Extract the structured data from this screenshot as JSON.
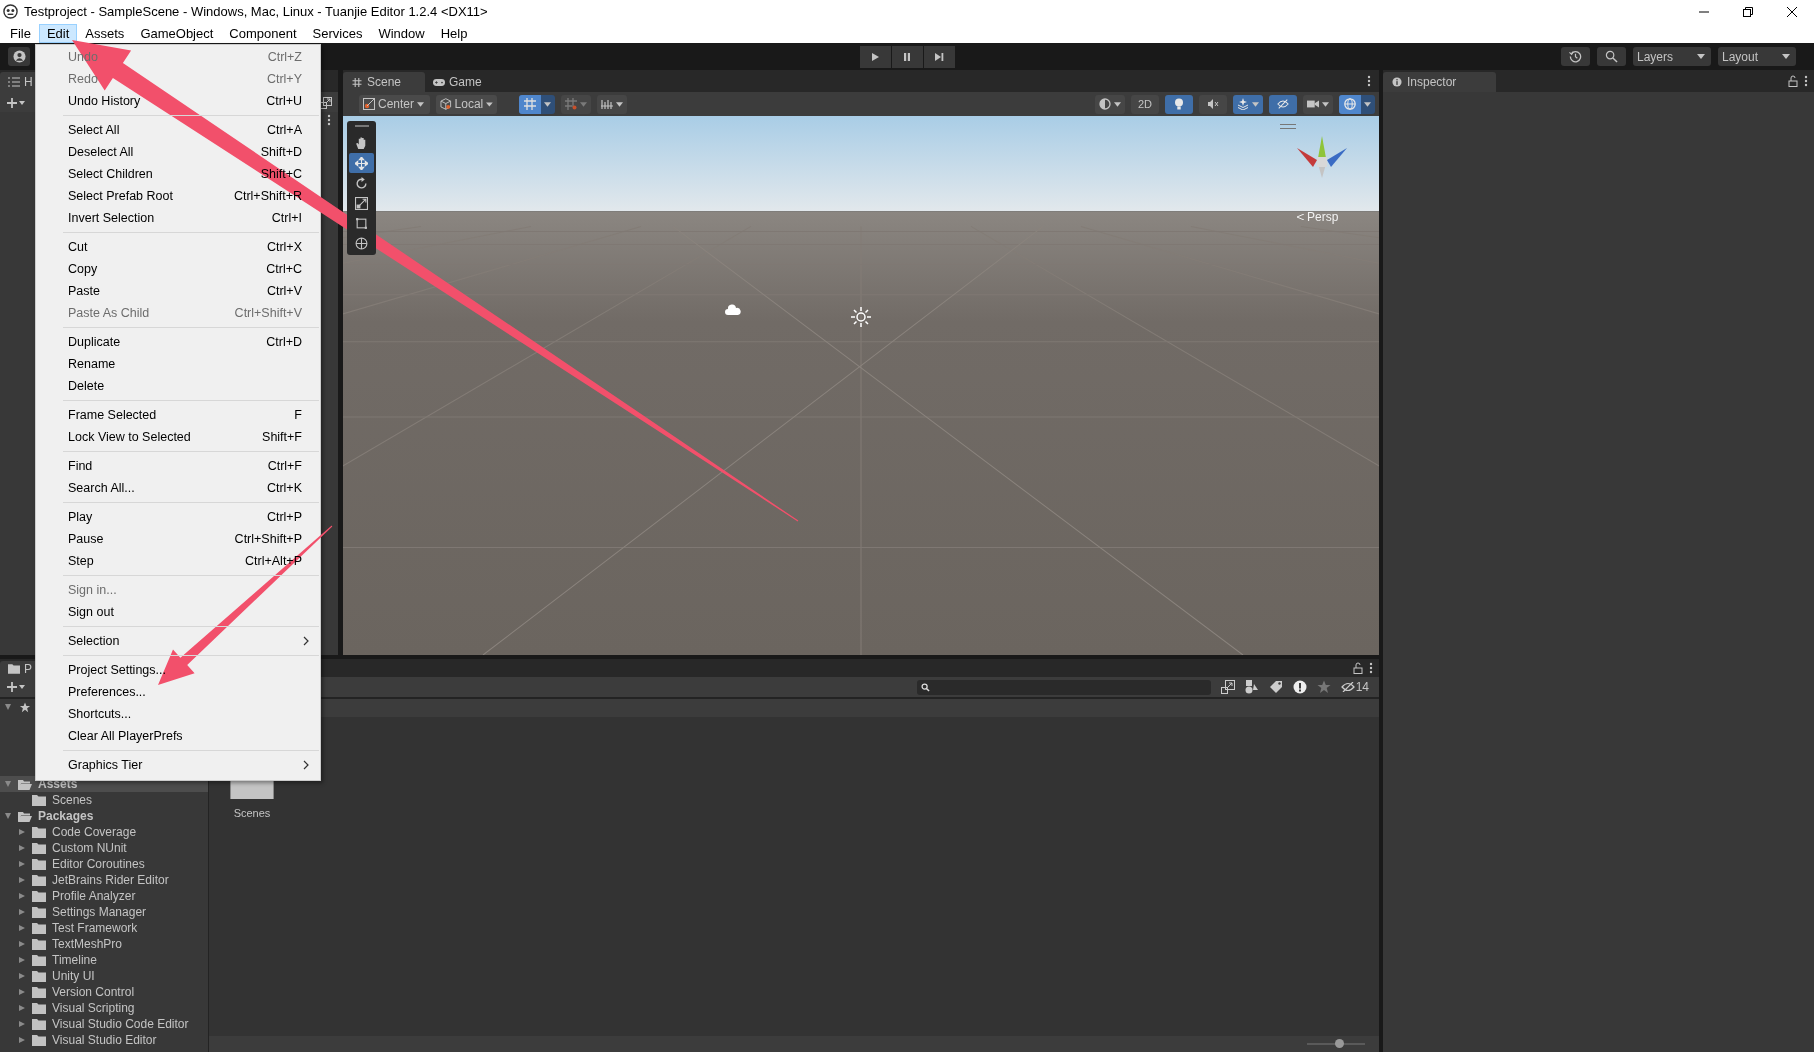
{
  "window": {
    "title": "Testproject - SampleScene - Windows, Mac, Linux - Tuanjie Editor 1.2.4 <DX11>"
  },
  "menu_bar": [
    {
      "label": "File",
      "selected": false
    },
    {
      "label": "Edit",
      "selected": true
    },
    {
      "label": "Assets",
      "selected": false
    },
    {
      "label": "GameObject",
      "selected": false
    },
    {
      "label": "Component",
      "selected": false
    },
    {
      "label": "Services",
      "selected": false
    },
    {
      "label": "Window",
      "selected": false
    },
    {
      "label": "Help",
      "selected": false
    }
  ],
  "toolbar": {
    "playing": false,
    "paused": false,
    "layers_label": "Layers",
    "layout_label": "Layout"
  },
  "hierarchy": {
    "tab_label": "H"
  },
  "scene_view": {
    "tabs": [
      {
        "label": "Scene",
        "selected": true
      },
      {
        "label": "Game",
        "selected": false
      }
    ],
    "pivot_label": "Center",
    "space_label": "Local",
    "grid_snap_on": true,
    "two_d_label": "2D",
    "two_d_on": false,
    "lighting_on": true,
    "audio_on": false,
    "effects_on": true,
    "hidden_objects_on": true,
    "gizmos_on": true,
    "tools": [
      {
        "selected": false
      },
      {
        "selected": true
      },
      {
        "selected": false
      },
      {
        "selected": false
      },
      {
        "selected": false
      },
      {
        "selected": false
      }
    ],
    "camera_label": "Persp"
  },
  "inspector": {
    "tab_label": "Inspector"
  },
  "project": {
    "tab_label": "P",
    "hidden_packages_count": "14",
    "favorites_expanded": true,
    "tree": [
      {
        "label": "Assets",
        "expanded": true,
        "selected": true,
        "children": [
          {
            "label": "Scenes",
            "selected": false
          }
        ]
      },
      {
        "label": "Packages",
        "expanded": true,
        "selected": false,
        "children": [
          {
            "label": "Code Coverage",
            "expanded": false,
            "selected": false
          },
          {
            "label": "Custom NUnit",
            "expanded": false,
            "selected": false
          },
          {
            "label": "Editor Coroutines",
            "expanded": false,
            "selected": false
          },
          {
            "label": "JetBrains Rider Editor",
            "expanded": false,
            "selected": false
          },
          {
            "label": "Profile Analyzer",
            "expanded": false,
            "selected": false
          },
          {
            "label": "Settings Manager",
            "expanded": false,
            "selected": false
          },
          {
            "label": "Test Framework",
            "expanded": false,
            "selected": false
          },
          {
            "label": "TextMeshPro",
            "expanded": false,
            "selected": false
          },
          {
            "label": "Timeline",
            "expanded": false,
            "selected": false
          },
          {
            "label": "Unity UI",
            "expanded": false,
            "selected": false
          },
          {
            "label": "Version Control",
            "expanded": false,
            "selected": false
          },
          {
            "label": "Visual Scripting",
            "expanded": false,
            "selected": false
          },
          {
            "label": "Visual Studio Code Editor",
            "expanded": false,
            "selected": false
          },
          {
            "label": "Visual Studio Editor",
            "expanded": false,
            "selected": false
          }
        ]
      }
    ],
    "items": [
      {
        "label": "Scenes"
      }
    ],
    "zoom_slider": {
      "level": 0.55
    }
  },
  "edit_menu": [
    {
      "kind": "item",
      "label": "Undo",
      "shortcut": "Ctrl+Z",
      "disabled": true
    },
    {
      "kind": "item",
      "label": "Redo",
      "shortcut": "Ctrl+Y",
      "disabled": true
    },
    {
      "kind": "item",
      "label": "Undo History",
      "shortcut": "Ctrl+U",
      "disabled": false
    },
    {
      "kind": "separator"
    },
    {
      "kind": "item",
      "label": "Select All",
      "shortcut": "Ctrl+A",
      "disabled": false
    },
    {
      "kind": "item",
      "label": "Deselect All",
      "shortcut": "Shift+D",
      "disabled": false
    },
    {
      "kind": "item",
      "label": "Select Children",
      "shortcut": "Shift+C",
      "disabled": false
    },
    {
      "kind": "item",
      "label": "Select Prefab Root",
      "shortcut": "Ctrl+Shift+R",
      "disabled": false
    },
    {
      "kind": "item",
      "label": "Invert Selection",
      "shortcut": "Ctrl+I",
      "disabled": false
    },
    {
      "kind": "separator"
    },
    {
      "kind": "item",
      "label": "Cut",
      "shortcut": "Ctrl+X",
      "disabled": false
    },
    {
      "kind": "item",
      "label": "Copy",
      "shortcut": "Ctrl+C",
      "disabled": false
    },
    {
      "kind": "item",
      "label": "Paste",
      "shortcut": "Ctrl+V",
      "disabled": false
    },
    {
      "kind": "item",
      "label": "Paste As Child",
      "shortcut": "Ctrl+Shift+V",
      "disabled": true
    },
    {
      "kind": "separator"
    },
    {
      "kind": "item",
      "label": "Duplicate",
      "shortcut": "Ctrl+D",
      "disabled": false
    },
    {
      "kind": "item",
      "label": "Rename",
      "disabled": false
    },
    {
      "kind": "item",
      "label": "Delete",
      "disabled": false
    },
    {
      "kind": "separator"
    },
    {
      "kind": "item",
      "label": "Frame Selected",
      "shortcut": "F",
      "disabled": false
    },
    {
      "kind": "item",
      "label": "Lock View to Selected",
      "shortcut": "Shift+F",
      "disabled": false
    },
    {
      "kind": "separator"
    },
    {
      "kind": "item",
      "label": "Find",
      "shortcut": "Ctrl+F",
      "disabled": false
    },
    {
      "kind": "item",
      "label": "Search All...",
      "shortcut": "Ctrl+K",
      "disabled": false
    },
    {
      "kind": "separator"
    },
    {
      "kind": "item",
      "label": "Play",
      "shortcut": "Ctrl+P",
      "disabled": false
    },
    {
      "kind": "item",
      "label": "Pause",
      "shortcut": "Ctrl+Shift+P",
      "disabled": false
    },
    {
      "kind": "item",
      "label": "Step",
      "shortcut": "Ctrl+Alt+P",
      "disabled": false
    },
    {
      "kind": "separator"
    },
    {
      "kind": "item",
      "label": "Sign in...",
      "disabled": true
    },
    {
      "kind": "item",
      "label": "Sign out",
      "disabled": false
    },
    {
      "kind": "separator"
    },
    {
      "kind": "submenu",
      "label": "Selection",
      "disabled": false
    },
    {
      "kind": "separator"
    },
    {
      "kind": "item",
      "label": "Project Settings...",
      "disabled": false
    },
    {
      "kind": "item",
      "label": "Preferences...",
      "disabled": false
    },
    {
      "kind": "item",
      "label": "Shortcuts...",
      "disabled": false
    },
    {
      "kind": "item",
      "label": "Clear All PlayerPrefs",
      "disabled": false
    },
    {
      "kind": "separator"
    },
    {
      "kind": "submenu",
      "label": "Graphics Tier",
      "disabled": false
    }
  ]
}
